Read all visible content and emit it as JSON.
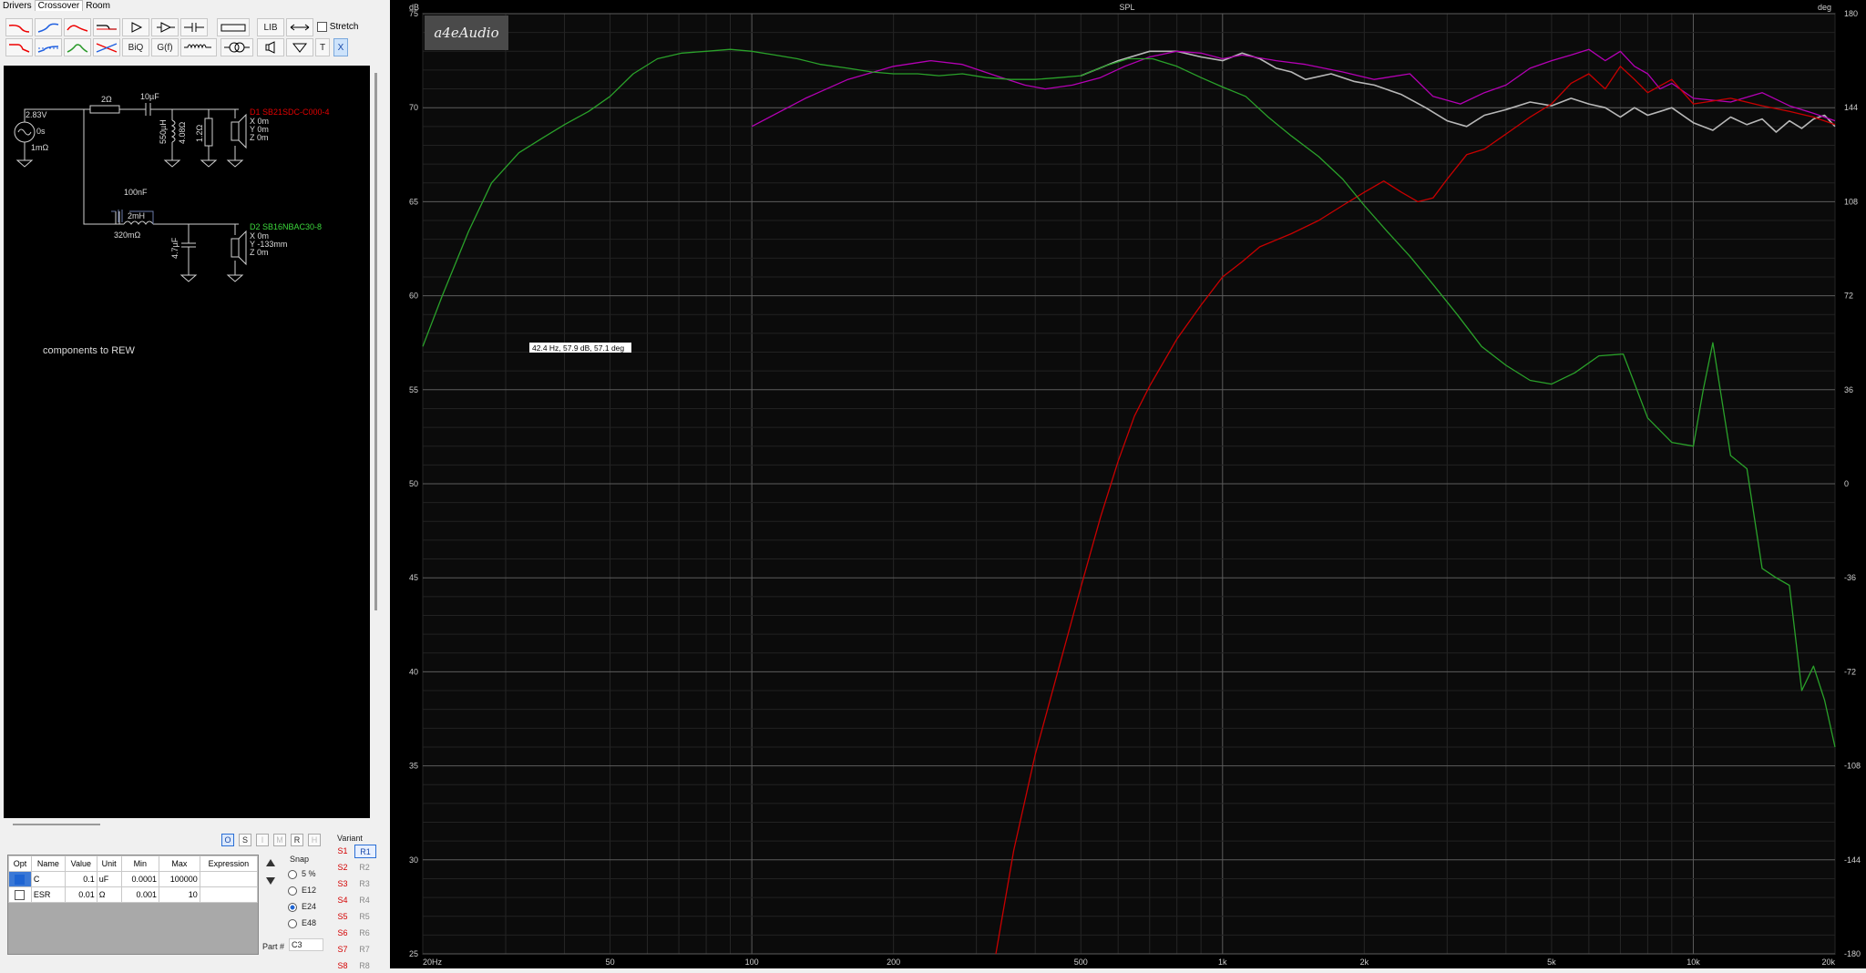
{
  "tabs": [
    "Drivers",
    "Crossover",
    "Room"
  ],
  "active_tab": "Crossover",
  "toolbar": {
    "lib": "LIB",
    "stretch": "Stretch",
    "biq": "BiQ",
    "gf": "G(f)",
    "t": "T",
    "x": "X"
  },
  "schematic": {
    "source_v": "2.83V",
    "source_delay": "0s",
    "source_r": "1mΩ",
    "r_series": "2Ω",
    "c_series": "10µF",
    "l_shunt": "550µH",
    "l_shunt_r": "4.08Ω",
    "r_shunt": "1.2Ω",
    "d1_name": "D1 SB21SDC-C000-4",
    "d1_x": "X 0m",
    "d1_y": "Y 0m",
    "d1_z": "Z 0m",
    "c_notch": "100nF",
    "l_series": "2mH",
    "l_series_r": "320mΩ",
    "c_shunt2": "4.7µF",
    "d2_name": "D2 SB16NBAC30-8",
    "d2_x": "X 0m",
    "d2_y": "Y -133mm",
    "d2_z": "Z 0m",
    "note": "components to REW"
  },
  "params": {
    "headers": [
      "Opt",
      "Name",
      "Value",
      "Unit",
      "Min",
      "Max",
      "Expression"
    ],
    "rows": [
      {
        "checked": true,
        "name": "C",
        "value": "0.1",
        "unit": "uF",
        "min": "0.0001",
        "max": "100000",
        "expr": ""
      },
      {
        "checked": false,
        "name": "ESR",
        "value": "0.01",
        "unit": "Ω",
        "min": "0.001",
        "max": "10",
        "expr": ""
      }
    ]
  },
  "mode_buttons": [
    "O",
    "S",
    "I",
    "M",
    "R",
    "H"
  ],
  "snap": {
    "label": "Snap",
    "options": [
      "5 %",
      "E12",
      "E24",
      "E48"
    ],
    "selected": "E24"
  },
  "part": {
    "label": "Part #",
    "value": "C3"
  },
  "variant": {
    "label": "Variant",
    "s": [
      "S1",
      "S2",
      "S3",
      "S4",
      "S5",
      "S6",
      "S7",
      "S8"
    ],
    "r": [
      "R1",
      "R2",
      "R3",
      "R4",
      "R5",
      "R6",
      "R7",
      "R8"
    ],
    "selected": "R1"
  },
  "chart_data": {
    "type": "line",
    "title": "SPL",
    "ylabel": "dB",
    "y2label": "deg",
    "xscale": "log",
    "xlim": [
      20,
      20000
    ],
    "ylim": [
      25,
      75
    ],
    "y2lim": [
      -180,
      180
    ],
    "x_tick_labels": [
      "20Hz",
      "50",
      "100",
      "200",
      "500",
      "1k",
      "2k",
      "5k",
      "10k",
      "20k"
    ],
    "y_ticks": [
      25,
      30,
      35,
      40,
      45,
      50,
      55,
      60,
      65,
      70,
      75
    ],
    "y2_ticks": [
      -180,
      -144,
      -108,
      -72,
      -36,
      0,
      36,
      72,
      108,
      144,
      180
    ],
    "grid": true,
    "logo": "a4eAudio",
    "cursor_readout": "42.4 Hz, 57.9 dB, 57.1 deg",
    "series": [
      {
        "color": "#b8b8b8",
        "x": [
          500,
          600,
          700,
          800,
          900,
          1000,
          1100,
          1200,
          1300,
          1400,
          1500,
          1700,
          1900,
          2100,
          2400,
          2700,
          3000,
          3300,
          3600,
          4000,
          4500,
          5000,
          5500,
          6000,
          6500,
          7000,
          7500,
          8000,
          8500,
          9000,
          10000,
          11000,
          12000,
          13000,
          14000,
          15000,
          16000,
          17000,
          18000,
          19000,
          20000
        ],
        "y": [
          71.7,
          72.5,
          73.0,
          73.0,
          72.7,
          72.5,
          72.9,
          72.6,
          72.1,
          71.9,
          71.5,
          71.8,
          71.4,
          71.2,
          70.7,
          70.0,
          69.3,
          69.0,
          69.6,
          69.9,
          70.3,
          70.1,
          70.5,
          70.2,
          70.0,
          69.5,
          70.0,
          69.6,
          69.8,
          70.0,
          69.2,
          68.8,
          69.5,
          69.1,
          69.4,
          68.7,
          69.3,
          68.9,
          69.4,
          69.6,
          69.0
        ]
      },
      {
        "color": "#b400b4",
        "x": [
          100,
          130,
          160,
          200,
          240,
          280,
          330,
          380,
          420,
          480,
          550,
          620,
          700,
          800,
          900,
          1000,
          1100,
          1300,
          1500,
          1800,
          2100,
          2500,
          2800,
          3200,
          3600,
          4000,
          4500,
          5000,
          5500,
          6000,
          6500,
          7000,
          7500,
          8000,
          8500,
          9000,
          10000,
          12000,
          14000,
          16000,
          18000,
          20000
        ],
        "y": [
          69,
          70.5,
          71.5,
          72.2,
          72.5,
          72.3,
          71.7,
          71.2,
          71.0,
          71.2,
          71.6,
          72.2,
          72.7,
          73.0,
          72.9,
          72.6,
          72.8,
          72.5,
          72.3,
          71.9,
          71.5,
          71.8,
          70.6,
          70.2,
          70.8,
          71.2,
          72.1,
          72.5,
          72.8,
          73.1,
          72.5,
          73.0,
          72.2,
          71.8,
          71.0,
          71.3,
          70.5,
          70.3,
          70.8,
          70.1,
          69.7,
          69.3
        ]
      },
      {
        "color": "#c80000",
        "x": [
          330,
          360,
          400,
          450,
          500,
          550,
          600,
          650,
          700,
          800,
          900,
          1000,
          1100,
          1200,
          1400,
          1600,
          1800,
          2000,
          2200,
          2400,
          2600,
          2800,
          3000,
          3300,
          3600,
          4000,
          4500,
          5000,
          5500,
          6000,
          6500,
          7000,
          7500,
          8000,
          9000,
          10000,
          12000,
          14000,
          16000,
          18000,
          20000
        ],
        "y": [
          25,
          30.5,
          35.6,
          40.3,
          44.5,
          48.2,
          51.2,
          53.6,
          55.2,
          57.7,
          59.5,
          61.0,
          61.8,
          62.6,
          63.3,
          64.0,
          64.8,
          65.5,
          66.1,
          65.5,
          65.0,
          65.2,
          66.2,
          67.5,
          67.8,
          68.6,
          69.5,
          70.2,
          71.3,
          71.8,
          71.0,
          72.2,
          71.5,
          70.8,
          71.5,
          70.2,
          70.5,
          70.1,
          69.8,
          69.5,
          69.1
        ]
      },
      {
        "color": "#2aa12a",
        "x": [
          20,
          22,
          25,
          28,
          32,
          36,
          40,
          45,
          50,
          56,
          63,
          71,
          80,
          90,
          100,
          112,
          125,
          140,
          160,
          180,
          200,
          225,
          250,
          280,
          315,
          355,
          400,
          450,
          500,
          560,
          630,
          710,
          800,
          900,
          1000,
          1120,
          1250,
          1400,
          1600,
          1800,
          2000,
          2240,
          2500,
          2800,
          3150,
          3550,
          4000,
          4500,
          5000,
          5600,
          6300,
          7100,
          8000,
          9000,
          10000,
          10500,
          11000,
          12000,
          13000,
          14000,
          15000,
          16000,
          17000,
          18000,
          19000,
          20000
        ],
        "y": [
          57.3,
          60,
          63.4,
          66,
          67.6,
          68.4,
          69.1,
          69.8,
          70.6,
          71.8,
          72.6,
          72.9,
          73.0,
          73.1,
          73.0,
          72.8,
          72.6,
          72.3,
          72.1,
          71.9,
          71.8,
          71.8,
          71.7,
          71.8,
          71.6,
          71.5,
          71.5,
          71.6,
          71.7,
          72.2,
          72.6,
          72.6,
          72.2,
          71.6,
          71.1,
          70.6,
          69.5,
          68.5,
          67.4,
          66.2,
          64.8,
          63.4,
          62.1,
          60.6,
          59.0,
          57.3,
          56.3,
          55.5,
          55.3,
          55.9,
          56.8,
          56.9,
          53.5,
          52.2,
          52.0,
          55.0,
          57.5,
          51.5,
          50.8,
          45.5,
          45.0,
          44.6,
          39.0,
          40.3,
          38.5,
          36.0
        ]
      }
    ]
  }
}
